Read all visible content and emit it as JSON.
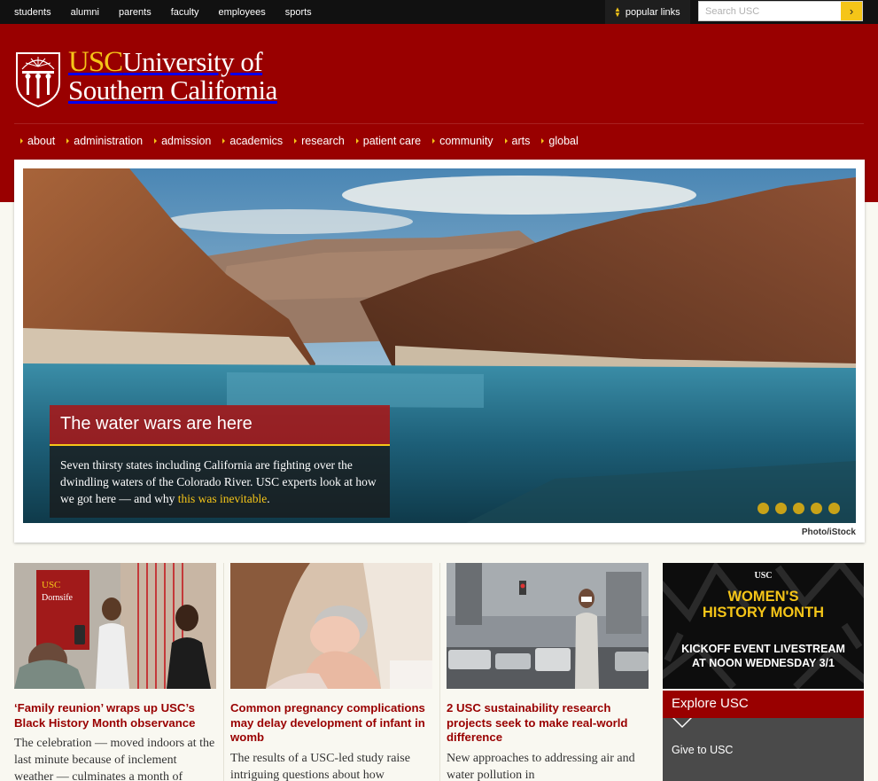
{
  "topbar": {
    "links": [
      "students",
      "alumni",
      "parents",
      "faculty",
      "employees",
      "sports"
    ],
    "popular_label": "popular links",
    "search_placeholder": "Search USC",
    "search_button": "›"
  },
  "header": {
    "logo_usc": "USC",
    "logo_line1": "University of",
    "logo_line2": "Southern California",
    "nav": [
      "about",
      "administration",
      "admission",
      "academics",
      "research",
      "patient care",
      "community",
      "arts",
      "global"
    ]
  },
  "hero": {
    "title": "The water wars are here",
    "body": "Seven thirsty states including California are fighting over the dwindling waters of the Colorado River. USC experts look at how we got here — and why ",
    "link_text": "this was inevitable",
    "body_end": ".",
    "credit": "Photo/iStock",
    "slide_count": 5
  },
  "news": [
    {
      "title": "‘Family reunion’ wraps up USC’s Black History Month observance",
      "body": "The celebration — moved indoors at the last minute because of inclement weather — culminates a month of"
    },
    {
      "title": "Common pregnancy complications may delay development of infant in womb",
      "body": "The results of a USC-led study raise intriguing questions about how"
    },
    {
      "title": "2 USC sustainability research projects seek to make real-world difference",
      "body": "New approaches to addressing air and water pollution in"
    }
  ],
  "promo": {
    "mark": "USC",
    "title_line1": "WOMEN'S",
    "title_line2": "HISTORY MONTH",
    "sub_line1": "KICKOFF EVENT LIVESTREAM",
    "sub_line2": "AT NOON WEDNESDAY 3/1"
  },
  "explore": {
    "heading": "Explore USC",
    "link": "Give to USC"
  },
  "colors": {
    "cardinal": "#990000",
    "gold": "#f5c518",
    "topbar": "#111111"
  }
}
